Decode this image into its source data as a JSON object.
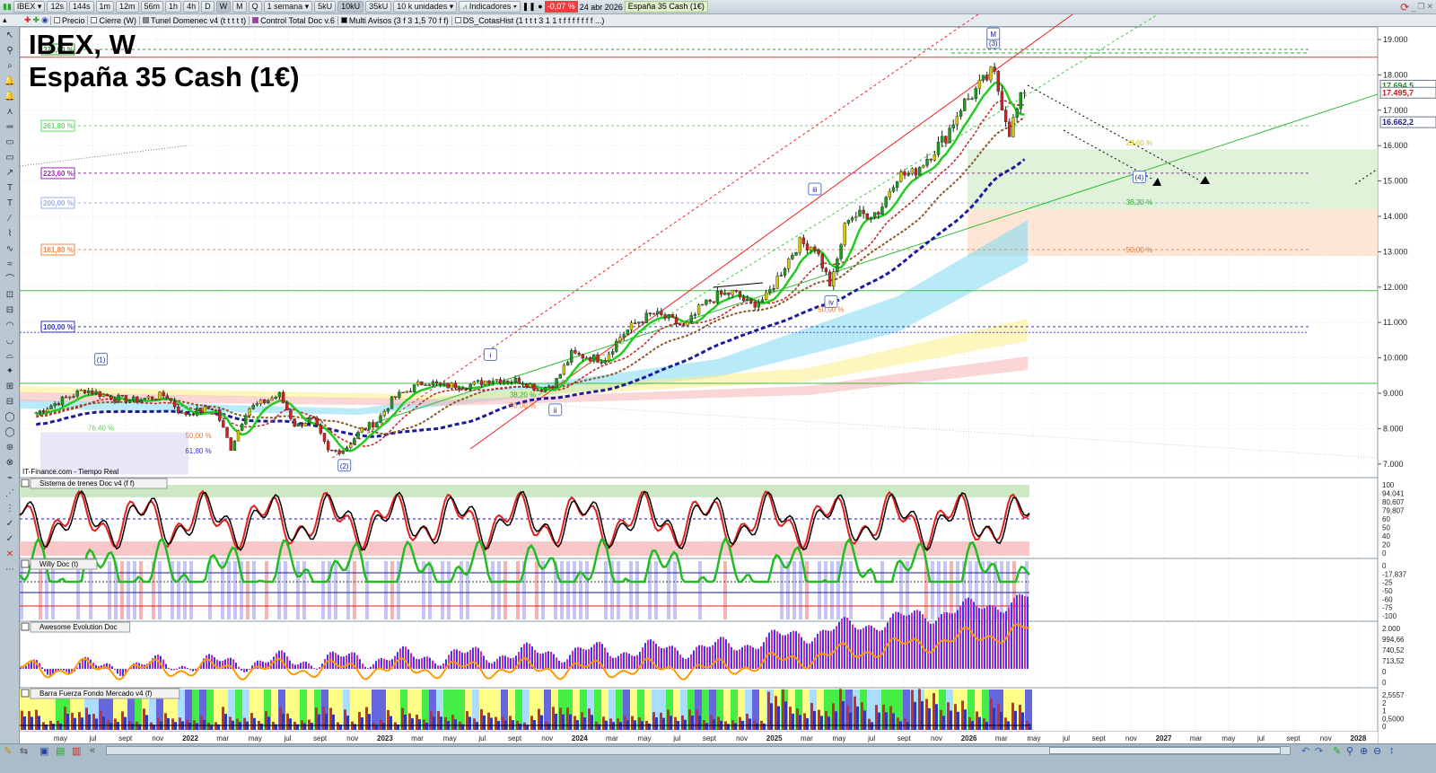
{
  "toolbar": {
    "symbol": "IBEX",
    "periods": [
      "12s",
      "144s",
      "1m",
      "12m",
      "56m",
      "1h",
      "4h",
      "D",
      "W",
      "M",
      "Q"
    ],
    "active_period": "W",
    "range": "1 semana",
    "units": [
      "5kU",
      "10kU",
      "35kU"
    ],
    "active_unit": "10kU",
    "units_select": "10 k unidades",
    "indicators": "Indicadores",
    "change": "-0,07 %",
    "date": "24 abr 2026",
    "instrument": "España 35 Cash (1€)"
  },
  "indicators_bar": [
    "Precio",
    "Cierre (W)",
    "Tunel Domenec v4 (t t t t t)",
    "Control Total Doc v.6",
    "Multi Avisos (3 f 3 1,5 70 f f)",
    "DS_CotasHist (1 t t t 3 1 1 t f f f f f f f ...)"
  ],
  "title": {
    "line1": "IBEX, W",
    "line2": "España 35 Cash (1€)"
  },
  "source": "IT-Finance.com - Tiempo Real",
  "colors": {
    "up": "#1a9e1a",
    "down": "#d42020",
    "ema": "#22cc22",
    "trend": "#1a1a9a"
  },
  "chart_data": [
    {
      "type": "candlestick",
      "title": "IBEX, W",
      "ylim": [
        6500,
        19500
      ],
      "yticks": [
        "19.000",
        "18.000",
        "17.000",
        "16.000",
        "15.000",
        "14.000",
        "13.000",
        "12.000",
        "11.000",
        "10.000",
        "9.000",
        "8.000",
        "7.000"
      ],
      "ytick_values": [
        19000,
        18000,
        17000,
        16000,
        15000,
        14000,
        13000,
        12000,
        11000,
        10000,
        9000,
        8000,
        7000
      ],
      "price_tags": [
        {
          "label": "17.694,5",
          "value": 17694.5,
          "color": "#2c8a2c"
        },
        {
          "label": "17.495,7",
          "value": 17495.7,
          "color": "#c02020"
        },
        {
          "label": "16.662,2",
          "value": 16662.2,
          "color": "#1a1a9a"
        }
      ],
      "closes": [
        [
          "2021-03",
          8450
        ],
        [
          "2021-05",
          8900
        ],
        [
          "2021-06",
          9100
        ],
        [
          "2021-08",
          8850
        ],
        [
          "2021-09",
          8800
        ],
        [
          "2021-11",
          8950
        ],
        [
          "2021-12",
          8400
        ],
        [
          "2022-02",
          8600
        ],
        [
          "2022-03",
          7450
        ],
        [
          "2022-04",
          8550
        ],
        [
          "2022-06",
          8950
        ],
        [
          "2022-07",
          8050
        ],
        [
          "2022-08",
          8300
        ],
        [
          "2022-09",
          7350
        ],
        [
          "2022-10",
          7400
        ],
        [
          "2022-11",
          7950
        ],
        [
          "2022-12",
          8200
        ],
        [
          "2023-01",
          8850
        ],
        [
          "2023-03",
          9350
        ],
        [
          "2023-04",
          9200
        ],
        [
          "2023-06",
          9250
        ],
        [
          "2023-07",
          9400
        ],
        [
          "2023-09",
          9350
        ],
        [
          "2023-10",
          9100
        ],
        [
          "2023-11",
          9300
        ],
        [
          "2023-12",
          10100
        ],
        [
          "2024-02",
          9950
        ],
        [
          "2024-03",
          10600
        ],
        [
          "2024-04",
          11000
        ],
        [
          "2024-05",
          11250
        ],
        [
          "2024-06",
          11100
        ],
        [
          "2024-07",
          10850
        ],
        [
          "2024-08",
          11450
        ],
        [
          "2024-09",
          11750
        ],
        [
          "2024-10",
          11850
        ],
        [
          "2024-11",
          11500
        ],
        [
          "2024-12",
          11700
        ],
        [
          "2025-01",
          12500
        ],
        [
          "2025-02",
          13250
        ],
        [
          "2025-03",
          13150
        ],
        [
          "2025-04",
          12000
        ],
        [
          "2025-05",
          14000
        ],
        [
          "2025-06",
          14050
        ],
        [
          "2025-07",
          14150
        ],
        [
          "2025-08",
          15150
        ],
        [
          "2025-09",
          15200
        ],
        [
          "2025-10",
          15700
        ],
        [
          "2025-11",
          16200
        ],
        [
          "2025-12",
          17100
        ],
        [
          "2026-01",
          17600
        ],
        [
          "2026-02",
          18100
        ],
        [
          "2026-03",
          16400
        ],
        [
          "2026-04",
          17700
        ]
      ],
      "fib_levels": [
        {
          "label": "323,60 %",
          "value": 18720,
          "color": "#2c9a2c"
        },
        {
          "label": "261,80 %",
          "value": 16560,
          "color": "#66dd66"
        },
        {
          "label": "223,60 %",
          "value": 15220,
          "color": "#9a2ab0"
        },
        {
          "label": "200,00 %",
          "value": 14380,
          "color": "#9ab0ee"
        },
        {
          "label": "161,80 %",
          "value": 13060,
          "color": "#ee8844"
        },
        {
          "label": "100,00 %",
          "value": 10880,
          "color": "#3333cc"
        }
      ],
      "annotations": [
        {
          "text": "(1)",
          "date": "2021-07",
          "value": 9950
        },
        {
          "text": "(2)",
          "date": "2022-10",
          "value": 6950
        },
        {
          "text": "i",
          "date": "2023-07",
          "value": 10080
        },
        {
          "text": "ii",
          "date": "2023-11",
          "value": 8520
        },
        {
          "text": "iii",
          "date": "2025-03",
          "value": 14760
        },
        {
          "text": "iv",
          "date": "2025-04",
          "value": 11580
        },
        {
          "text": "(3)",
          "date": "2026-02",
          "value": 18900
        },
        {
          "text": "(4)",
          "date": "2026-11",
          "value": 15100
        },
        {
          "text": "M",
          "date": "2026-02",
          "value": 19150
        }
      ],
      "retracements": [
        {
          "text": "23,60 %",
          "date": "2026-11",
          "value": 16000,
          "color": "#d8c000"
        },
        {
          "text": "38,20 %",
          "date": "2026-11",
          "value": 14330,
          "color": "#33aa33"
        },
        {
          "text": "50,00 %",
          "date": "2026-11",
          "value": 12990,
          "color": "#ee7733"
        },
        {
          "text": "38,20 %",
          "date": "2023-09",
          "value": 8880,
          "color": "#33aa33"
        },
        {
          "text": "50,00 %",
          "date": "2023-09",
          "value": 8580,
          "color": "#ee7733"
        },
        {
          "text": "76,40 %",
          "date": "2021-07",
          "value": 7950,
          "color": "#66cc66"
        },
        {
          "text": "50,00 %",
          "date": "2022-01",
          "value": 7730,
          "color": "#ee7733"
        },
        {
          "text": "61,80 %",
          "date": "2022-01",
          "value": 7300,
          "color": "#3333cc"
        },
        {
          "text": "50,00 %",
          "date": "2025-04",
          "value": 11300,
          "color": "#ee7733"
        }
      ]
    },
    {
      "type": "oscillator",
      "title": "Sistema de trenes Doc v4 (f f)",
      "yticks": [
        "100",
        "94,041",
        "80,607",
        "79,807",
        "60",
        "50",
        "40",
        "20",
        "0"
      ]
    },
    {
      "type": "oscillator",
      "title": "Willy Doc (t)",
      "yticks": [
        "0",
        "-17,837",
        "-25",
        "-50",
        "-60",
        "-75",
        "-100"
      ]
    },
    {
      "type": "histogram",
      "title": "Awesome Evolution Doc",
      "yticks": [
        "2.000",
        "994,66",
        "740,52",
        "713,52",
        "0",
        "0"
      ]
    },
    {
      "type": "histogram",
      "title": "Barra Fuerza Fondo Mercado v4 (f)",
      "yticks": [
        "2,5557",
        "2",
        "1",
        "0,5000",
        "0"
      ]
    }
  ],
  "time_axis": [
    "may",
    "jul",
    "sept",
    "nov",
    "2022",
    "mar",
    "may",
    "jul",
    "sept",
    "nov",
    "2023",
    "mar",
    "may",
    "jul",
    "sept",
    "nov",
    "2024",
    "mar",
    "may",
    "jul",
    "sept",
    "nov",
    "2025",
    "mar",
    "may",
    "jul",
    "sept",
    "nov",
    "2026",
    "mar",
    "may",
    "jul",
    "sept",
    "nov",
    "2027",
    "mar",
    "may",
    "jul",
    "sept",
    "nov",
    "2028"
  ]
}
